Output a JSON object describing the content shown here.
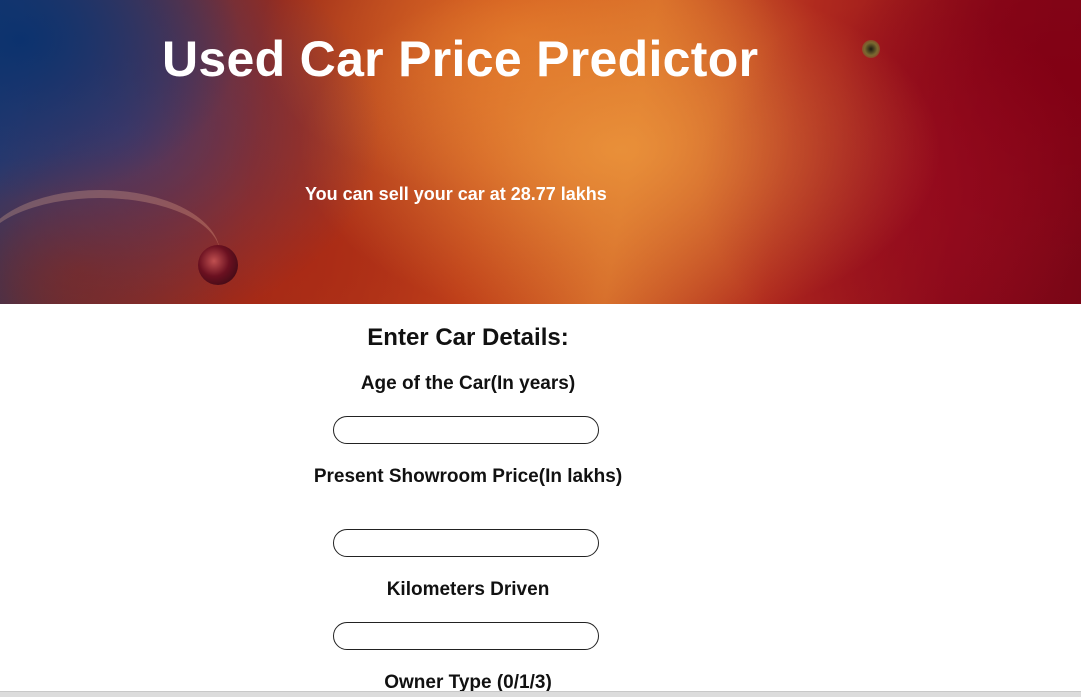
{
  "header": {
    "title": "Used Car Price Predictor",
    "result_text": "You can sell your car at 28.77 lakhs"
  },
  "form": {
    "heading": "Enter Car Details:",
    "fields": [
      {
        "label": "Age of the Car(In years)",
        "value": ""
      },
      {
        "label": "Present Showroom Price(In lakhs)",
        "value": ""
      },
      {
        "label": "Kilometers Driven",
        "value": ""
      },
      {
        "label": "Owner Type (0/1/3)",
        "value": ""
      }
    ]
  },
  "colors": {
    "title_text": "#ffffff",
    "body_text": "#111111",
    "input_border": "#222222"
  }
}
